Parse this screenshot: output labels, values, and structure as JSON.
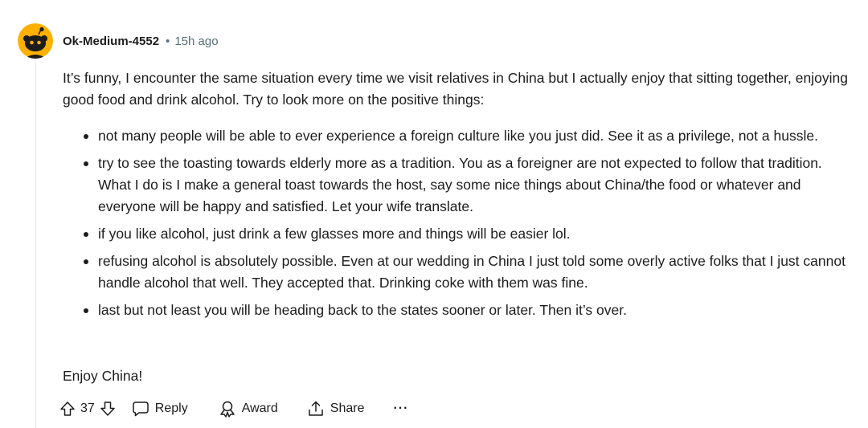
{
  "comment": {
    "author": "Ok-Medium-4552",
    "separator": "•",
    "time": "15h ago",
    "intro": "It’s funny, I encounter the same situation every time we visit relatives in China but I actually enjoy that sitting together, enjoying good food and drink alcohol. Try to look more on the positive things:",
    "bullets": [
      "not many people will be able to ever experience a foreign culture like you just did. See it as a privilege, not a hussle.",
      "try to see the toasting towards elderly more as a tradition. You as a foreigner are not expected to follow that tradition. What I do is I make a general toast towards the host, say some nice things about China/the food or whatever and everyone will be happy and satisfied. Let your wife translate.",
      "if you like alcohol, just drink a few glasses more and things will be easier lol.",
      "refusing alcohol is absolutely possible. Even at our wedding in China I just told some overly active folks that I just cannot handle alcohol that well. They accepted that. Drinking coke with them was fine.",
      "last but not least you will be heading back to the states sooner or later. Then it’s over."
    ],
    "signoff": "Enjoy China!"
  },
  "actions": {
    "vote_count": "37",
    "reply_label": "Reply",
    "award_label": "Award",
    "share_label": "Share",
    "more_label": "···"
  },
  "icons": {
    "avatar": "snoo-avatar-icon",
    "upvote": "arrow-up-icon",
    "downvote": "arrow-down-icon",
    "reply": "speech-bubble-icon",
    "award": "award-ribbon-icon",
    "share": "share-upload-icon",
    "more": "ellipsis-icon"
  },
  "colors": {
    "avatar_bg": "#FFB000",
    "meta_text": "#576F76",
    "text": "#1C1C1C",
    "thread_line": "#E5EBEE"
  }
}
